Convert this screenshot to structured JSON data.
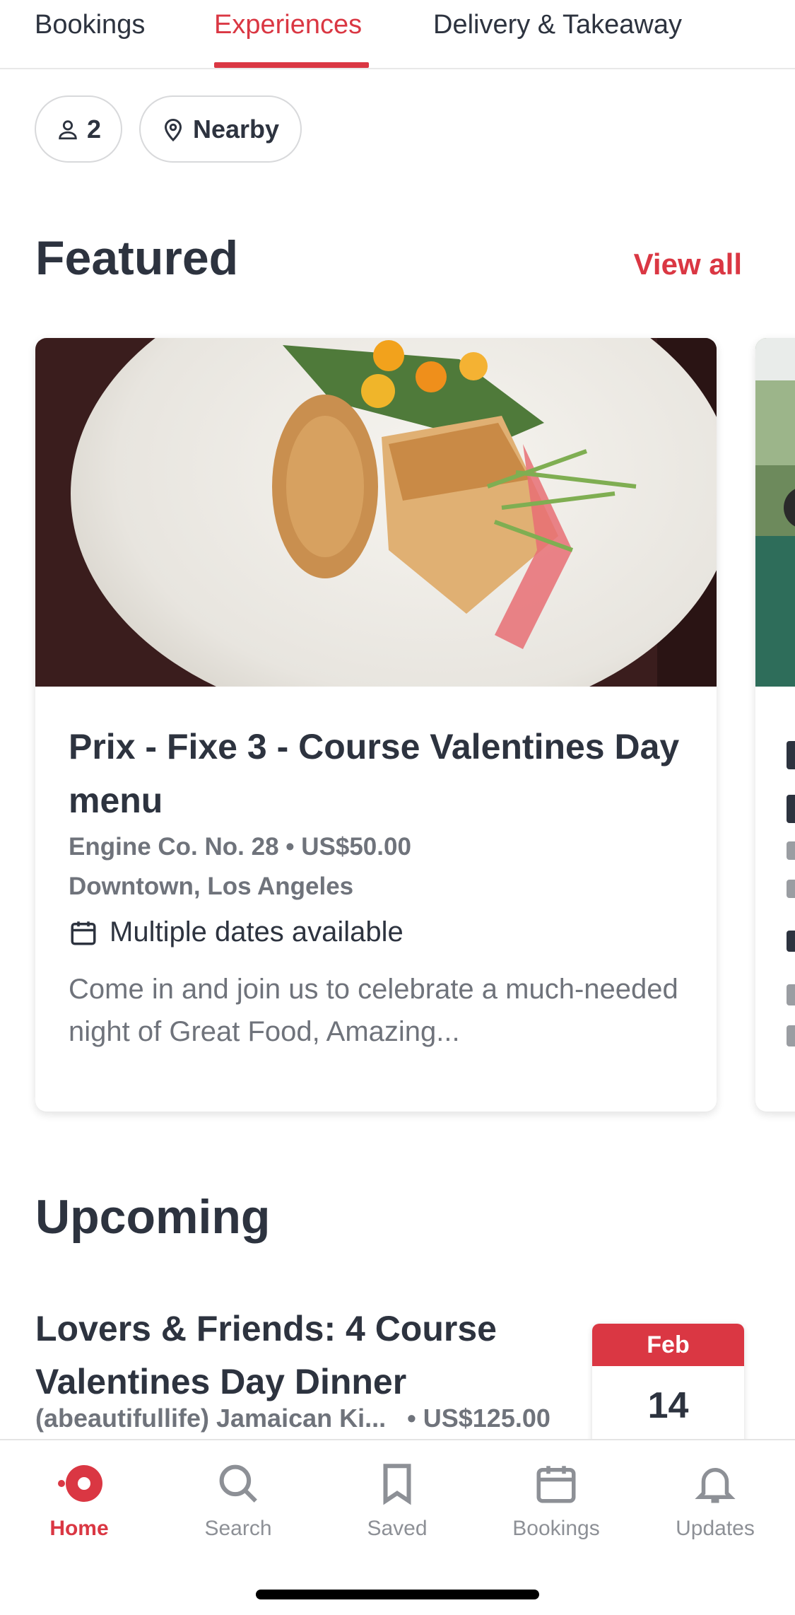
{
  "top_tabs": [
    {
      "label": "Bookings"
    },
    {
      "label": "Experiences",
      "active": true
    },
    {
      "label": "Delivery & Takeaway"
    }
  ],
  "filters": {
    "party_size": "2",
    "location": "Nearby"
  },
  "featured": {
    "title": "Featured",
    "view_all": "View all",
    "card": {
      "title": "Prix -  Fixe 3 - Course Valentines Day menu",
      "restaurant_price": "Engine Co. No. 28 • US$50.00",
      "location": "Downtown, Los Angeles",
      "dates": "Multiple dates available",
      "description": "Come in and join us to celebrate a much-needed night of Great Food, Amazing..."
    }
  },
  "upcoming": {
    "title": "Upcoming",
    "item": {
      "title": "Lovers & Friends: 4 Course Valentines Day Dinner",
      "restaurant": "(abeautifullife) Jamaican Ki...",
      "price": "• US$125.00",
      "month": "Feb",
      "day": "14"
    }
  },
  "bottom_nav": [
    {
      "label": "Home",
      "icon": "home-dot-icon",
      "active": true
    },
    {
      "label": "Search",
      "icon": "search-icon"
    },
    {
      "label": "Saved",
      "icon": "bookmark-icon"
    },
    {
      "label": "Bookings",
      "icon": "calendar-icon"
    },
    {
      "label": "Updates",
      "icon": "bell-icon"
    }
  ],
  "colors": {
    "accent": "#da3743",
    "text": "#2d333f",
    "muted": "#6f737b"
  }
}
